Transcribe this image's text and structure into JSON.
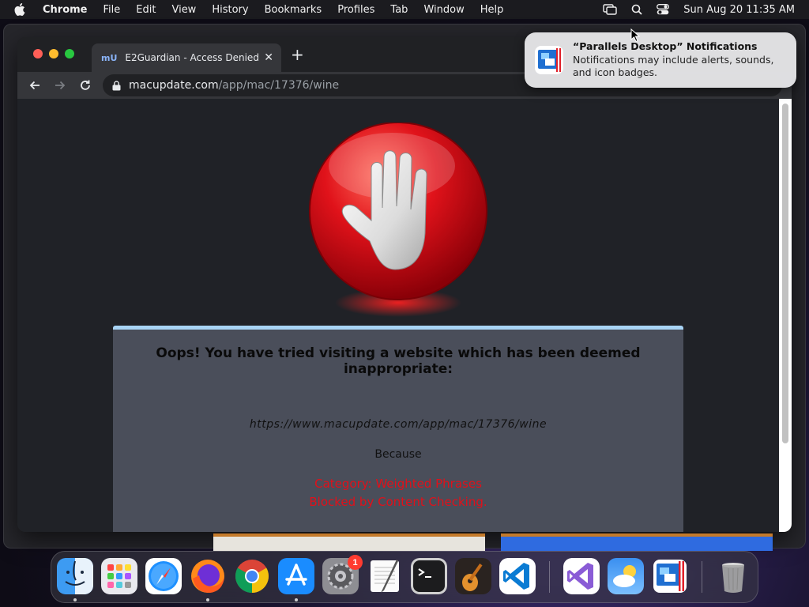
{
  "menubar": {
    "app_name": "Chrome",
    "items": [
      "File",
      "Edit",
      "View",
      "History",
      "Bookmarks",
      "Profiles",
      "Tab",
      "Window",
      "Help"
    ],
    "clock": "Sun Aug 20  11:35 AM",
    "icons": [
      "apple-icon",
      "screen-mirroring-icon",
      "spotlight-search-icon",
      "control-center-icon"
    ]
  },
  "browser": {
    "tab_title": "E2Guardian - Access Denied",
    "favicon": "mU",
    "url_host": "macupdate.com",
    "url_path": "/app/mac/17376/wine"
  },
  "page": {
    "headline": "Oops! You have tried visiting a website which has been deemed inappropriate:",
    "blocked_url": "https://www.macupdate.com/app/mac/17376/wine",
    "because": "Because",
    "reason_category": "Category: Weighted Phrases",
    "reason_detail": "Blocked by Content Checking.",
    "colors": {
      "reason": "#e0101a",
      "card_border": "#a8d4f5",
      "card_bg": "#4a4e5a",
      "page_bg": "#202227"
    }
  },
  "notification": {
    "title": "“Parallels Desktop” Notifications",
    "body": "Notifications may include alerts, sounds, and icon badges."
  },
  "dock": {
    "apps": [
      "Finder",
      "Launchpad",
      "Safari",
      "Firefox",
      "Google Chrome",
      "App Store",
      "System Settings",
      "TextEdit",
      "Terminal",
      "GarageBand",
      "Visual Studio Code",
      "Visual Studio",
      "Weather",
      "Parallels Desktop",
      "Trash"
    ],
    "settings_badge": "1",
    "running": [
      "Finder",
      "Firefox",
      "App Store"
    ]
  }
}
